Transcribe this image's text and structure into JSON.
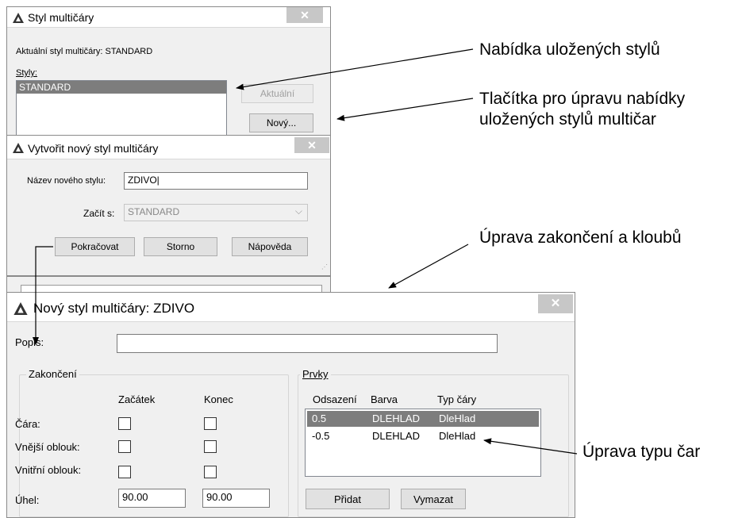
{
  "dialog1": {
    "title": "Styl multičáry",
    "current_label": "Aktuální styl multičáry: STANDARD",
    "styles_label": "Styly:",
    "styles": [
      "STANDARD"
    ],
    "btn_current": "Aktuální",
    "btn_new": "Nový..."
  },
  "dialog2": {
    "title": "Vytvořit nový styl multičáry",
    "name_label": "Název nového stylu:",
    "name_value": "ZDIVO",
    "start_label": "Začít s:",
    "start_value": "STANDARD",
    "btn_continue": "Pokračovat",
    "btn_cancel": "Storno",
    "btn_help": "Nápověda"
  },
  "dialog3": {
    "title": "Nový styl multičáry: ZDIVO",
    "desc_label": "Popis:",
    "desc_value": "",
    "caps": {
      "legend": "Zakončení",
      "col_start": "Začátek",
      "col_end": "Konec",
      "rows": [
        "Čára:",
        "Vnější oblouk:",
        "Vnitřní oblouk:"
      ],
      "angle_label": "Úhel:",
      "angle_start": "90.00",
      "angle_end": "90.00"
    },
    "elements": {
      "legend": "Prvky",
      "headers": [
        "Odsazení",
        "Barva",
        "Typ čáry"
      ],
      "rows": [
        {
          "offset": "0.5",
          "color": "DLEHLAD",
          "linetype": "DleHlad"
        },
        {
          "offset": "-0.5",
          "color": "DLEHLAD",
          "linetype": "DleHlad"
        }
      ],
      "btn_add": "Přidat",
      "btn_delete": "Vymazat"
    }
  },
  "callouts": {
    "saved_styles": "Nabídka uložených stylů",
    "buttons_line1": "Tlačítka pro úpravu nabídky",
    "buttons_line2": "uložených stylů multičar",
    "caps_joints": "Úprava zakončení a kloubů",
    "linetype": "Úprava typu čar"
  },
  "colors": {
    "dialog_bg": "#f0f0f0",
    "selection": "#7d7d7d",
    "close_button": "#c7c7c7",
    "focused_button_border": "#3c7fb1"
  },
  "icons": [
    "autocad-logo-icon",
    "close-icon",
    "chevron-down-icon",
    "resize-grip-icon"
  ]
}
